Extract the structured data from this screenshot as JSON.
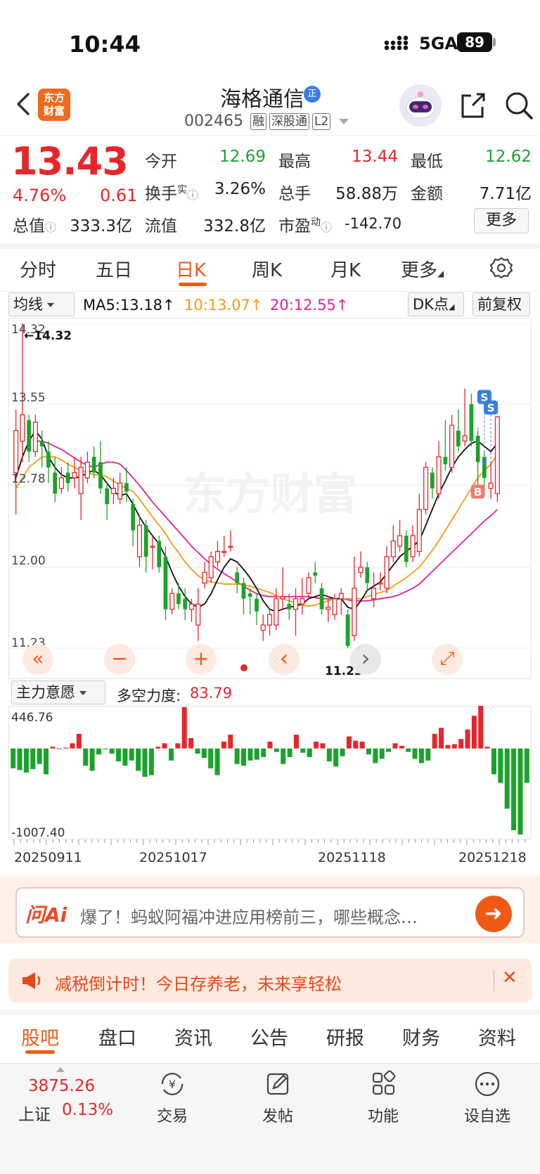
{
  "status_bar": {
    "time": "10:44",
    "network": "5GA",
    "battery": "89"
  },
  "header": {
    "logo": "东方\n财富",
    "stock_name": "海格通信",
    "badge": "正",
    "code": "002465",
    "tags": [
      "融",
      "深股通",
      "L2"
    ]
  },
  "quote": {
    "price": "13.43",
    "change_pct": "4.76%",
    "change_amt": "0.61",
    "open_label": "今开",
    "open": "12.69",
    "high_label": "最高",
    "high": "13.44",
    "low_label": "最低",
    "low": "12.62",
    "turnover_label": "换手",
    "turnover_sup": "实",
    "turnover": "3.26%",
    "volume_label": "总手",
    "volume": "58.88万",
    "amount_label": "金额",
    "amount": "7.71亿",
    "mktcap_label": "总值",
    "mktcap": "333.3亿",
    "float_label": "流值",
    "float": "332.8亿",
    "pe_label": "市盈",
    "pe_sup": "动",
    "pe": "-142.70",
    "more": "更多"
  },
  "chart_tabs": [
    "分时",
    "五日",
    "日K",
    "周K",
    "月K",
    "更多"
  ],
  "active_chart_tab": "日K",
  "ma_row": {
    "selector": "均线",
    "ma5": "MA5:13.18↑",
    "ma10": "10:13.07↑",
    "ma20": "20:12.55↑",
    "dk": "DK点",
    "adjust": "前复权"
  },
  "colors": {
    "up": "#e8252b",
    "down": "#1aa32a",
    "ma5": "#111111",
    "ma10": "#f39a14",
    "ma20": "#e0229a",
    "accent": "#f05a14"
  },
  "chart_data": {
    "type": "candlestick",
    "y_labels": [
      "14.32",
      "13.55",
      "12.78",
      "12.00",
      "11.23"
    ],
    "ylim": [
      11.23,
      14.32
    ],
    "high_marker": "14.32",
    "low_marker": "11.23",
    "watermark": "东方财富",
    "candles": [
      [
        12.9,
        13.3,
        13.5,
        12.5
      ],
      [
        13.2,
        13.45,
        14.32,
        13.0
      ],
      [
        13.4,
        13.1,
        13.45,
        13.0
      ],
      [
        13.1,
        13.38,
        13.45,
        13.05
      ],
      [
        13.2,
        13.15,
        13.3,
        12.95
      ],
      [
        13.1,
        12.95,
        13.2,
        12.8
      ],
      [
        12.9,
        12.7,
        13.05,
        12.62
      ],
      [
        12.75,
        12.85,
        12.95,
        12.7
      ],
      [
        12.9,
        12.8,
        13.0,
        12.72
      ],
      [
        12.85,
        12.9,
        13.05,
        12.75
      ],
      [
        12.7,
        12.95,
        13.05,
        12.45
      ],
      [
        12.85,
        13.0,
        13.1,
        12.8
      ],
      [
        13.05,
        12.9,
        13.15,
        12.85
      ],
      [
        13.0,
        12.75,
        13.2,
        12.7
      ],
      [
        12.75,
        12.6,
        12.8,
        12.45
      ],
      [
        12.7,
        12.75,
        12.85,
        12.6
      ],
      [
        12.65,
        12.8,
        12.9,
        12.6
      ],
      [
        12.8,
        12.72,
        12.95,
        12.62
      ],
      [
        12.6,
        12.35,
        12.65,
        12.2
      ],
      [
        12.1,
        12.4,
        12.5,
        12.0
      ],
      [
        12.4,
        12.1,
        12.45,
        11.95
      ],
      [
        12.2,
        12.2,
        12.3,
        11.98
      ],
      [
        12.25,
        12.0,
        12.3,
        11.95
      ],
      [
        12.1,
        11.6,
        12.2,
        11.5
      ],
      [
        11.6,
        11.75,
        11.8,
        11.55
      ],
      [
        11.75,
        11.65,
        11.85,
        11.6
      ],
      [
        11.7,
        11.6,
        11.8,
        11.5
      ],
      [
        11.6,
        11.65,
        11.7,
        11.48
      ],
      [
        11.45,
        11.65,
        11.8,
        11.3
      ],
      [
        11.85,
        11.95,
        12.05,
        11.8
      ],
      [
        11.9,
        12.1,
        12.15,
        11.85
      ],
      [
        12.05,
        12.15,
        12.25,
        12.0
      ],
      [
        12.15,
        12.15,
        12.3,
        12.1
      ],
      [
        12.2,
        12.2,
        12.35,
        12.15
      ],
      [
        11.95,
        11.85,
        12.0,
        11.75
      ],
      [
        11.85,
        11.7,
        11.9,
        11.55
      ],
      [
        11.75,
        11.72,
        11.8,
        11.55
      ],
      [
        11.7,
        11.58,
        11.75,
        11.45
      ],
      [
        11.4,
        11.45,
        11.55,
        11.3
      ],
      [
        11.45,
        11.55,
        11.6,
        11.35
      ],
      [
        11.45,
        11.7,
        11.8,
        11.4
      ],
      [
        11.7,
        11.72,
        12.0,
        11.6
      ],
      [
        11.65,
        11.6,
        11.75,
        11.5
      ],
      [
        11.6,
        11.7,
        11.8,
        11.35
      ],
      [
        11.65,
        11.7,
        11.9,
        11.55
      ],
      [
        11.75,
        11.9,
        11.95,
        11.7
      ],
      [
        11.95,
        11.92,
        12.05,
        11.85
      ],
      [
        11.8,
        11.6,
        11.85,
        11.55
      ],
      [
        11.6,
        11.62,
        11.7,
        11.48
      ],
      [
        11.55,
        11.7,
        11.75,
        11.5
      ],
      [
        11.7,
        11.75,
        11.8,
        11.55
      ],
      [
        11.55,
        11.25,
        11.6,
        11.23
      ],
      [
        11.35,
        11.8,
        12.1,
        11.3
      ],
      [
        11.95,
        12.0,
        12.15,
        11.9
      ],
      [
        12.0,
        11.85,
        12.05,
        11.78
      ],
      [
        11.7,
        11.8,
        11.95,
        11.62
      ],
      [
        11.85,
        11.85,
        11.95,
        11.78
      ],
      [
        11.8,
        12.1,
        12.2,
        11.75
      ],
      [
        12.1,
        12.25,
        12.4,
        12.05
      ],
      [
        12.2,
        12.3,
        12.45,
        12.15
      ],
      [
        12.3,
        12.05,
        12.35,
        12.0
      ],
      [
        12.1,
        12.3,
        12.4,
        12.05
      ],
      [
        12.15,
        12.55,
        12.7,
        12.1
      ],
      [
        12.55,
        12.95,
        13.0,
        12.5
      ],
      [
        12.9,
        12.75,
        12.95,
        12.65
      ],
      [
        12.7,
        13.05,
        13.2,
        12.65
      ],
      [
        13.05,
        12.98,
        13.4,
        12.92
      ],
      [
        12.95,
        13.35,
        13.45,
        12.9
      ],
      [
        13.3,
        13.15,
        13.5,
        13.1
      ],
      [
        13.2,
        13.25,
        13.7,
        13.15
      ],
      [
        13.55,
        13.2,
        13.65,
        13.15
      ],
      [
        13.25,
        13.0,
        13.3,
        12.8
      ],
      [
        13.05,
        12.85,
        13.1,
        12.7
      ],
      [
        12.75,
        12.8,
        13.0,
        12.65
      ],
      [
        12.7,
        13.43,
        13.44,
        12.62
      ]
    ],
    "ma5": [
      12.85,
      13.05,
      13.2,
      13.3,
      13.22,
      13.05,
      12.95,
      12.88,
      12.85,
      12.85,
      12.86,
      12.9,
      12.92,
      12.88,
      12.8,
      12.72,
      12.68,
      12.7,
      12.6,
      12.48,
      12.38,
      12.3,
      12.22,
      12.1,
      11.95,
      11.82,
      11.72,
      11.65,
      11.62,
      11.65,
      11.75,
      11.88,
      12.0,
      12.08,
      12.05,
      11.98,
      11.9,
      11.8,
      11.68,
      11.6,
      11.58,
      11.6,
      11.62,
      11.63,
      11.65,
      11.7,
      11.72,
      11.74,
      11.72,
      11.7,
      11.7,
      11.62,
      11.6,
      11.68,
      11.78,
      11.82,
      11.86,
      11.94,
      12.02,
      12.1,
      12.15,
      12.2,
      12.25,
      12.4,
      12.55,
      12.7,
      12.82,
      12.95,
      13.05,
      13.12,
      13.18,
      13.2,
      13.15,
      13.1,
      13.18
    ],
    "ma10": [
      12.75,
      12.85,
      12.95,
      13.0,
      13.05,
      13.05,
      13.05,
      13.02,
      12.98,
      12.95,
      12.92,
      12.9,
      12.88,
      12.88,
      12.86,
      12.82,
      12.78,
      12.75,
      12.72,
      12.65,
      12.56,
      12.48,
      12.4,
      12.32,
      12.22,
      12.14,
      12.05,
      11.98,
      11.92,
      11.88,
      11.86,
      11.85,
      11.84,
      11.84,
      11.84,
      11.83,
      11.82,
      11.8,
      11.78,
      11.76,
      11.73,
      11.7,
      11.68,
      11.66,
      11.64,
      11.63,
      11.64,
      11.66,
      11.68,
      11.7,
      11.7,
      11.7,
      11.7,
      11.7,
      11.72,
      11.74,
      11.76,
      11.78,
      11.82,
      11.86,
      11.9,
      11.95,
      12.0,
      12.08,
      12.16,
      12.25,
      12.35,
      12.45,
      12.55,
      12.65,
      12.75,
      12.85,
      12.92,
      12.98,
      13.07
    ],
    "ma20": [
      null,
      null,
      null,
      13.2,
      13.2,
      13.18,
      13.15,
      13.12,
      13.08,
      13.04,
      13.0,
      12.97,
      12.95,
      12.98,
      13.0,
      13.0,
      12.98,
      12.92,
      12.85,
      12.78,
      12.7,
      12.62,
      12.55,
      12.48,
      12.41,
      12.34,
      12.27,
      12.2,
      12.14,
      12.08,
      12.03,
      11.98,
      11.94,
      11.9,
      11.86,
      11.82,
      11.78,
      11.75,
      11.73,
      11.72,
      11.72,
      11.72,
      11.72,
      11.72,
      11.72,
      11.72,
      11.71,
      11.7,
      11.7,
      11.7,
      11.7,
      11.69,
      11.68,
      11.68,
      11.68,
      11.69,
      11.7,
      11.71,
      11.72,
      11.74,
      11.77,
      11.8,
      11.84,
      11.9,
      11.96,
      12.02,
      12.08,
      12.14,
      12.2,
      12.26,
      12.32,
      12.38,
      12.44,
      12.49,
      12.55
    ]
  },
  "chart_controls": {
    "rewind": "«",
    "zoom_out": "−",
    "zoom_in": "+",
    "prev": "‹",
    "next": "›",
    "expand": "⤢",
    "buy_marker": "B",
    "sell_marker": "S"
  },
  "indicator": {
    "selector": "主力意愿",
    "label": "多空力度:",
    "value": "83.79",
    "max_label": "446.76",
    "min_label": "-1007.40",
    "ylim": [
      -1007.4,
      446.76
    ],
    "bars": [
      -230,
      -250,
      -280,
      -240,
      -180,
      -300,
      20,
      0,
      10,
      60,
      170,
      -200,
      -260,
      -70,
      -10,
      -60,
      -150,
      -200,
      -140,
      -260,
      -330,
      -310,
      20,
      60,
      -140,
      60,
      480,
      120,
      -60,
      -110,
      -230,
      -310,
      80,
      160,
      -180,
      -200,
      -140,
      -130,
      -100,
      80,
      -40,
      -180,
      -100,
      160,
      -50,
      -100,
      80,
      60,
      -150,
      -210,
      -90,
      140,
      90,
      80,
      -70,
      -170,
      -120,
      -40,
      60,
      30,
      -40,
      -120,
      -170,
      -140,
      170,
      240,
      40,
      50,
      110,
      220,
      380,
      510,
      20,
      -300,
      -400,
      -700,
      -950,
      -1000,
      -400
    ]
  },
  "x_labels": [
    "20250911",
    "20251017",
    "20251118",
    "20251218"
  ],
  "ai_box": {
    "logo": "问Ai",
    "text": "爆了！蚂蚁阿福冲进应用榜前三，哪些概念…"
  },
  "banner": {
    "text": "减税倒计时！今日存养老，未来享轻松"
  },
  "bottom_tabs": [
    "股吧",
    "盘口",
    "资讯",
    "公告",
    "研报",
    "财务",
    "资料"
  ],
  "bottom_nav": {
    "index_value": "3875.26",
    "index_name": "上证",
    "index_change": "0.13%",
    "items": [
      "交易",
      "发帖",
      "功能",
      "设自选"
    ]
  }
}
